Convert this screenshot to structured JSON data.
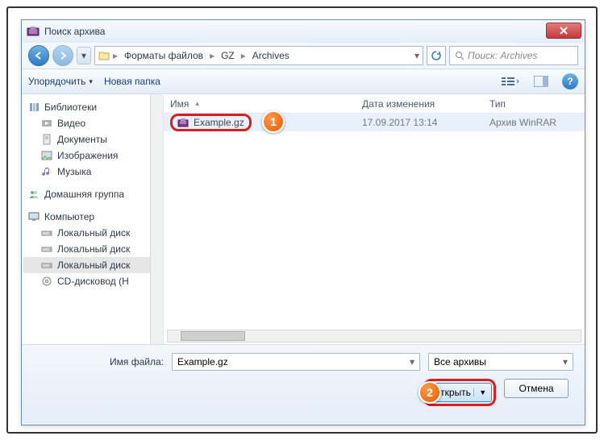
{
  "window": {
    "title": "Поиск архива"
  },
  "nav": {
    "segments": [
      "Форматы файлов",
      "GZ",
      "Archives"
    ],
    "search_placeholder": "Поиск: Archives"
  },
  "toolbar": {
    "organize": "Упорядочить",
    "new_folder": "Новая папка"
  },
  "tree": {
    "libraries": {
      "label": "Библиотеки",
      "items": [
        "Видео",
        "Документы",
        "Изображения",
        "Музыка"
      ]
    },
    "homegroup": {
      "label": "Домашняя группа"
    },
    "computer": {
      "label": "Компьютер",
      "items": [
        "Локальный диск",
        "Локальный диск",
        "Локальный диск",
        "CD-дисковод (H"
      ]
    }
  },
  "columns": {
    "name": "Имя",
    "date": "Дата изменения",
    "type": "Тип"
  },
  "files": [
    {
      "name": "Example.gz",
      "date": "17.09.2017 13:14",
      "type": "Архив WinRAR"
    }
  ],
  "footer": {
    "filename_label": "Имя файла:",
    "filename_value": "Example.gz",
    "filter": "Все архивы",
    "open": "Открыть",
    "cancel": "Отмена"
  },
  "callouts": {
    "one": "1",
    "two": "2"
  }
}
